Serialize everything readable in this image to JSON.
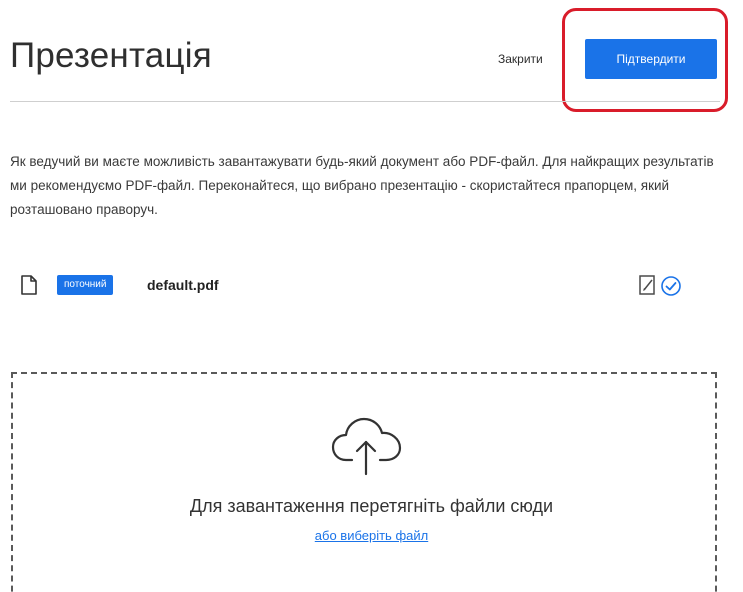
{
  "header": {
    "title": "Презентація",
    "close_label": "Закрити",
    "confirm_label": "Підтвердити"
  },
  "description": "Як ведучий ви маєте можливість завантажувати будь-який документ або PDF-файл. Для найкращих результатів ми рекомендуємо PDF-файл. Переконайтеся, що вибрано презентацію - скористайтеся прапорцем, який розташовано праворуч.",
  "files": [
    {
      "badge": "поточний",
      "name": "default.pdf"
    }
  ],
  "dropzone": {
    "text": "Для завантаження перетягніть файли сюди",
    "browse_label": "або виберіть файл"
  },
  "icons": {
    "file": "file-icon",
    "set_current": "document-edit-icon",
    "check": "check-circle-icon",
    "upload": "cloud-upload-icon"
  },
  "colors": {
    "accent": "#1a73e8",
    "highlight": "#d91c2a"
  }
}
